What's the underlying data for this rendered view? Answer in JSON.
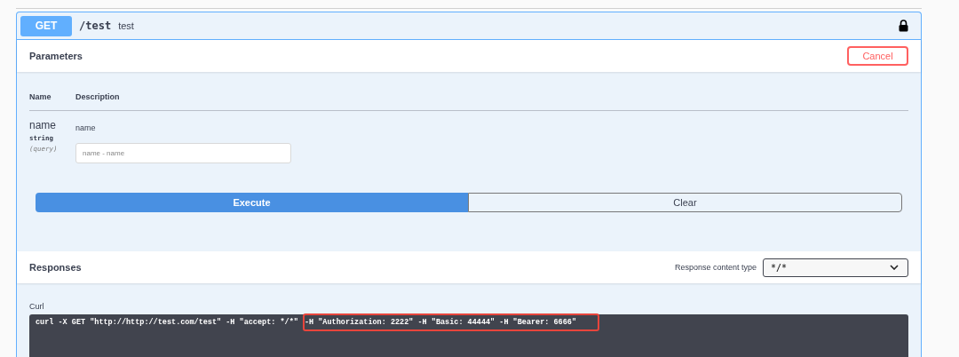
{
  "operation": {
    "method": "GET",
    "path": "/test",
    "summary": "test",
    "locked": true
  },
  "parameters": {
    "title": "Parameters",
    "cancel_button": "Cancel",
    "columns": [
      "Name",
      "Description"
    ],
    "rows": [
      {
        "name": "name",
        "type": "string",
        "location": "(query)",
        "description": "name",
        "placeholder": "name - name"
      }
    ]
  },
  "actions": {
    "execute": "Execute",
    "clear": "Clear"
  },
  "responses": {
    "title": "Responses",
    "content_type_label": "Response content type",
    "content_type": "*/*"
  },
  "curl": {
    "label": "Curl",
    "command": "curl -X GET \"http://http://test.com/test\" -H \"accept: */*\"",
    "highlighted": "-H \"Authorization: 2222\" -H \"Basic: 44444\" -H \"Bearer: 6666\""
  }
}
